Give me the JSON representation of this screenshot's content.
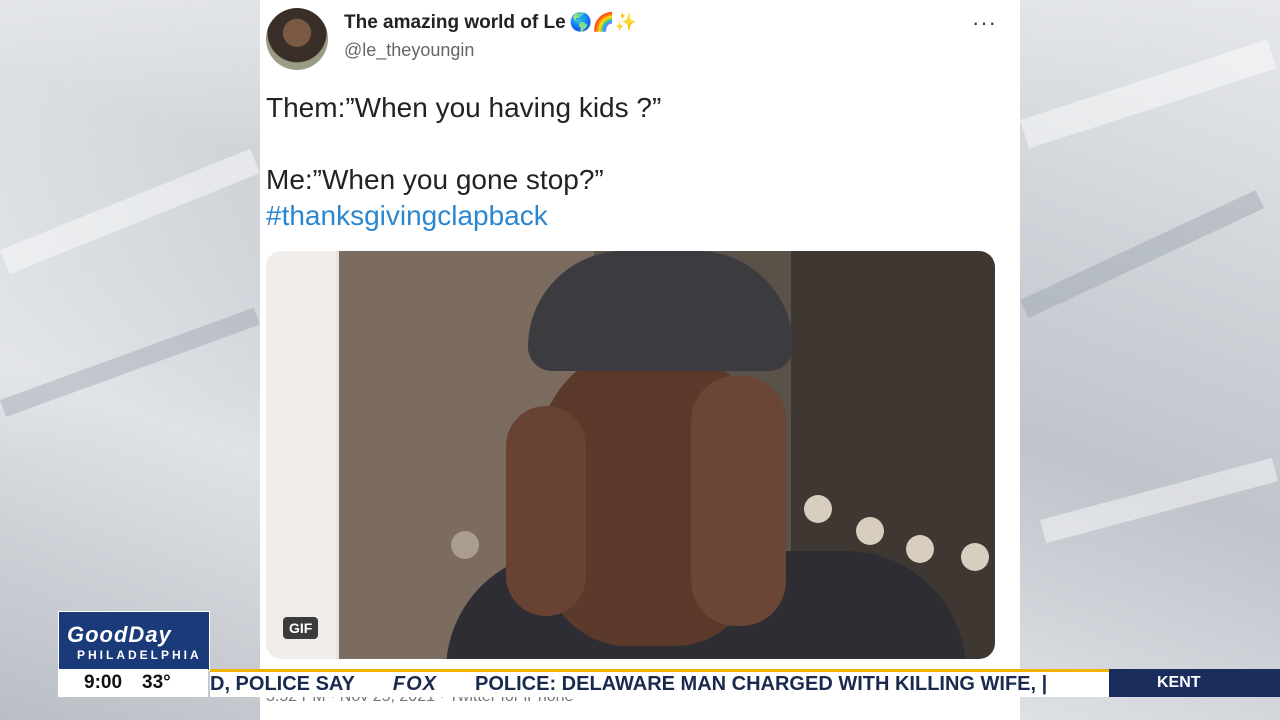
{
  "tweet": {
    "display_name": "The amazing world of Le",
    "name_emojis": "🌎🌈✨",
    "handle": "@le_theyoungin",
    "more_label": "···",
    "text_lines": [
      "Them:”When you having kids ?”",
      "Me:”When you gone stop?”"
    ],
    "hashtag": "#thanksgivingclapback",
    "media_badge": "GIF",
    "meta": "3:52 PM · Nov 25, 2021 · Twitter for iPhone"
  },
  "broadcast": {
    "logo_main": "GoodDay",
    "logo_sub": "PHILADELPHIA",
    "time": "9:00",
    "temperature": "33°",
    "ticker_left": "D, POLICE SAY",
    "network": "FOX",
    "ticker_right": "POLICE: DELAWARE MAN CHARGED WITH KILLING WIFE, |",
    "location": "KENT"
  }
}
